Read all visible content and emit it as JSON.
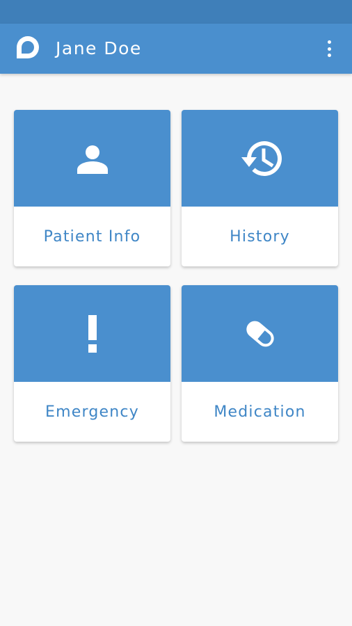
{
  "app": {
    "title": "Jane Doe",
    "logo_icon": "app-logo-icon",
    "menu_icon": "more-vert-icon"
  },
  "colors": {
    "status_bar": "#3f7fb9",
    "primary": "#4a8fce",
    "label_text": "#3f86c6",
    "background": "#f8f8f8"
  },
  "tiles": [
    {
      "label": "Patient Info",
      "icon": "person-icon"
    },
    {
      "label": "History",
      "icon": "history-icon"
    },
    {
      "label": "Emergency",
      "icon": "exclamation-icon"
    },
    {
      "label": "Medication",
      "icon": "pill-icon"
    }
  ]
}
